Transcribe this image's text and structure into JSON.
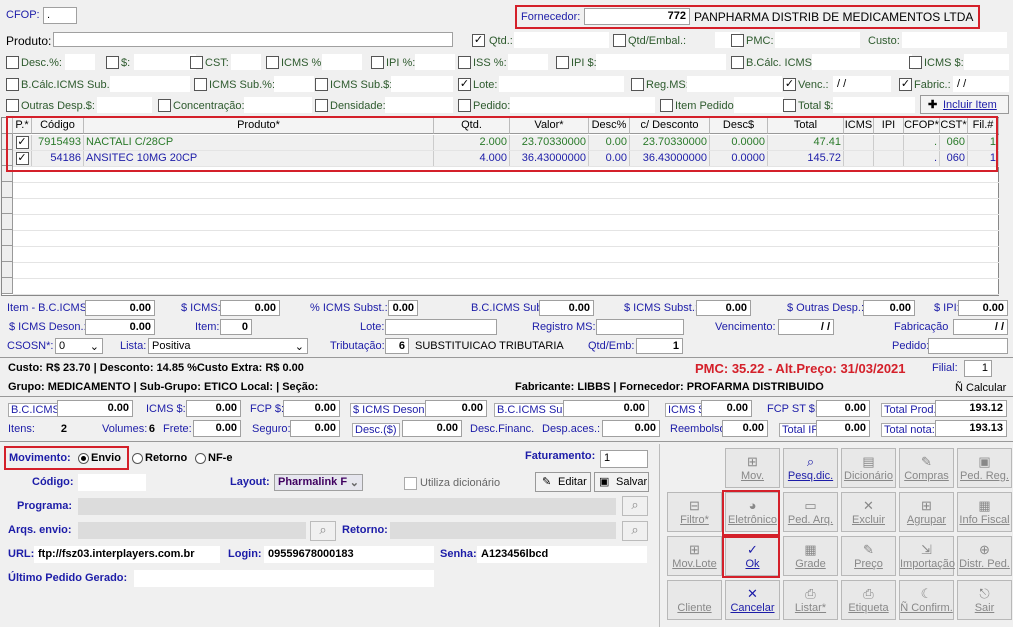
{
  "top": {
    "cfop_label": "CFOP:",
    "cfop_value": ".",
    "fornecedor_label": "Fornecedor:",
    "fornecedor_code": "772",
    "fornecedor_name": "PANPHARMA DISTRIB DE MEDICAMENTOS LTDA",
    "produto_label": "Produto:"
  },
  "filters": {
    "qtd": "Qtd.:",
    "qtd_embal": "Qtd/Embal.:",
    "pmc": "PMC:",
    "custo": "Custo:",
    "desc_pct": "Desc.%:",
    "dollar": "$:",
    "cst": "CST:",
    "icms_pct": "ICMS %:",
    "ipi_pct": "IPI %:",
    "iss_pct": "ISS %:",
    "ipi_dollar": "IPI $:",
    "bcalc_icms": "B.Cálc. ICMS:",
    "icms_dollar": "ICMS $:",
    "bcalc_icms_sub": "B.Cálc.ICMS Sub.:",
    "icms_sub_pct": "ICMS Sub.%:",
    "icms_sub_dollar": "ICMS Sub.$:",
    "lote": "Lote:",
    "reg_ms": "Reg.MS:",
    "venc": "Venc.:",
    "venc_value": "/ /",
    "fabric": "Fabric.:",
    "fabric_value": "/ /",
    "outras_desp": "Outras Desp.$:",
    "concentracao": "Concentração:",
    "densidade": "Densidade:",
    "pedido": "Pedido:",
    "item_pedido": "Item Pedido:",
    "total_dollar": "Total $:",
    "incluir_item": "Incluir Item"
  },
  "grid": {
    "headers": [
      "P.*",
      "Código",
      "Produto*",
      "Qtd.",
      "Valor*",
      "Desc%",
      "c/ Desconto",
      "Desc$",
      "Total",
      "ICMS",
      "IPI",
      "CFOP*",
      "CST*",
      "Fil.#"
    ],
    "rows": [
      [
        "",
        "7915493",
        "NACTALI C/28CP",
        "2.000",
        "23.70330000",
        "0.00",
        "23.70330000",
        "0.0000",
        "47.41",
        "",
        "",
        ".",
        "060",
        "1"
      ],
      [
        "",
        "54186",
        "ANSITEC 10MG 20CP",
        "4.000",
        "36.43000000",
        "0.00",
        "36.43000000",
        "0.0000",
        "145.72",
        "",
        "",
        ".",
        "060",
        "1"
      ]
    ]
  },
  "item": {
    "item_bc_icms": "Item - B.C.ICMS:",
    "item_bc_icms_v": "0.00",
    "s_icms": "$ ICMS:",
    "s_icms_v": "0.00",
    "pct_icms_subst": "% ICMS Subst.:",
    "pct_icms_subst_v": "0.00",
    "bc_icms_subst": "B.C.ICMS Subst.:",
    "bc_icms_subst_v": "0.00",
    "s_icms_subst": "$ ICMS Subst.:",
    "s_icms_subst_v": "0.00",
    "s_outras_desp": "$ Outras Desp.:",
    "s_outras_desp_v": "0.00",
    "s_ipi": "$ IPI:",
    "s_ipi_v": "0.00",
    "s_icms_deson": "$ ICMS Deson.:",
    "s_icms_deson_v": "0.00",
    "item_label": "Item:",
    "item_v": "0",
    "lote": "Lote:",
    "registro_ms": "Registro MS:",
    "vencimento": "Vencimento:",
    "vencimento_v": "/ /",
    "fabricacao": "Fabricação",
    "fabricacao_v": "/ /",
    "csosn": "CSOSN*:",
    "csosn_v": "0",
    "lista": "Lista:",
    "lista_v": "Positiva",
    "tributacao": "Tributação:",
    "tributacao_code": "6",
    "tributacao_desc": "SUBSTITUICAO TRIBUTARIA",
    "qtd_emb": "Qtd/Emb:",
    "qtd_emb_v": "1",
    "pedido": "Pedido:"
  },
  "info": {
    "custo_line": "Custo:  R$ 23.70 |  Desconto:  14.85 %Custo Extra:  R$ 0.00",
    "pmc_line": "PMC:     35.22 - Alt.Preço: 31/03/2021",
    "filial_label": "Filial:",
    "filial_v": "1",
    "grupo_line": "Grupo: MEDICAMENTO  |  Sub-Grupo: ETICO Local:   |  Seção:",
    "fabricante_line": "Fabricante: LIBBS  |  Fornecedor: PROFARMA DISTRIBUIDO",
    "calcular": "Ñ Calcular"
  },
  "totals": {
    "bc_icms": "B.C.ICMS:",
    "bc_icms_v": "0.00",
    "icms_s": "ICMS $:",
    "icms_s_v": "0.00",
    "fcp_s": "FCP $:",
    "fcp_s_v": "0.00",
    "s_icms_deson": "$ ICMS Deson.:",
    "s_icms_deson_v": "0.00",
    "bc_icms_sub": "B.C.ICMS Sub",
    "bc_icms_sub_v": "0.00",
    "icms_s2": "ICMS $:",
    "icms_s2_v": "0.00",
    "fcp_st": "FCP ST $:",
    "fcp_st_v": "0.00",
    "total_prod": "Total Prod.:",
    "total_prod_v": "193.12",
    "itens": "Itens:",
    "itens_v": "2",
    "volumes": "Volumes:",
    "volumes_v": "6",
    "frete": "Frete:",
    "frete_v": "0.00",
    "seguro": "Seguro:",
    "seguro_v": "0.00",
    "desc": "Desc.($)",
    "desc_v": "0.00",
    "desc_financ": "Desc.Financ.",
    "desp_aces": "Desp.aces.:",
    "desp_aces_v": "0.00",
    "reembolso": "Reembolso:",
    "reembolso_v": "0.00",
    "total_ipi": "Total IPI:",
    "total_ipi_v": "0.00",
    "total_nota": "Total nota:",
    "total_nota_v": "193.13"
  },
  "bottom": {
    "movimento": "Movimento:",
    "envio": "Envio",
    "retorno": "Retorno",
    "nfe": "NF-e",
    "faturamento": "Faturamento:",
    "faturamento_v": "1",
    "codigo": "Código:",
    "layout": "Layout:",
    "layout_v": "Pharmalink F",
    "utiliza": "Utiliza dicionário",
    "editar": "Editar",
    "salvar": "Salvar",
    "programa": "Programa:",
    "arqs_envio": "Arqs. envio:",
    "retorno_lbl": "Retorno:",
    "url": "URL:",
    "url_v": "ftp://fsz03.interplayers.com.br",
    "login": "Login:",
    "login_v": "09559678000183",
    "senha": "Senha:",
    "senha_v": "A123456lbcd",
    "ultimo": "Último Pedido Gerado:"
  },
  "buttons": [
    {
      "label": "Mov.",
      "icon": "⊞",
      "on": false
    },
    {
      "label": "Pesq.dic.",
      "icon": "⌕",
      "on": true
    },
    {
      "label": "Dicionário",
      "icon": "▤",
      "on": false
    },
    {
      "label": "Compras",
      "icon": "✎",
      "on": false
    },
    {
      "label": "Ped. Reg.",
      "icon": "▣",
      "on": false
    },
    {
      "label": "Filtro*",
      "icon": "⊟",
      "on": false
    },
    {
      "label": "Eletrônico",
      "icon": "◕",
      "on": false
    },
    {
      "label": "Ped. Arq.",
      "icon": "▭",
      "on": false
    },
    {
      "label": "Excluir",
      "icon": "✕",
      "on": false
    },
    {
      "label": "Agrupar",
      "icon": "⊞",
      "on": false
    },
    {
      "label": "Info Fiscal",
      "icon": "▦",
      "on": false
    },
    {
      "label": "Mov.Lote",
      "icon": "⊞",
      "on": false
    },
    {
      "label": "Ok",
      "icon": "✓",
      "on": true
    },
    {
      "label": "Grade",
      "icon": "▦",
      "on": false
    },
    {
      "label": "Preço",
      "icon": "✎",
      "on": false
    },
    {
      "label": "Importação",
      "icon": "⇲",
      "on": false
    },
    {
      "label": "Distr. Ped.",
      "icon": "⊕",
      "on": false
    },
    {
      "label": "Cliente",
      "icon": "",
      "on": false
    },
    {
      "label": "Cancelar",
      "icon": "✕",
      "on": true
    },
    {
      "label": "Listar*",
      "icon": "⎙",
      "on": false
    },
    {
      "label": "Etiqueta",
      "icon": "⎙",
      "on": false
    },
    {
      "label": "Ñ Confirm.",
      "icon": "☾",
      "on": false
    },
    {
      "label": "Sair",
      "icon": "⎋",
      "on": false
    }
  ]
}
